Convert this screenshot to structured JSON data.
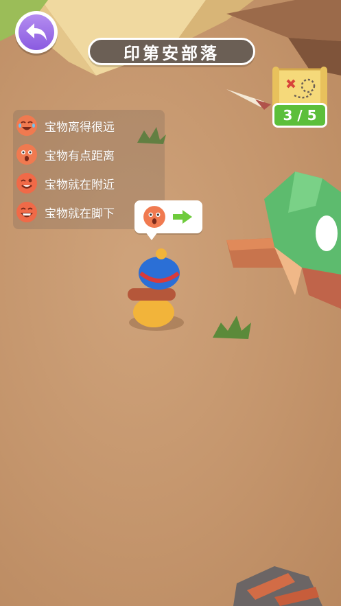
{
  "game": {
    "title": "印第安部落",
    "back_icon": "back-arrow-icon",
    "treasure_progress": {
      "found": 3,
      "total": 5,
      "label": "3 / 5"
    },
    "legend": [
      {
        "label": "宝物离得很远",
        "face": "crying-laugh-face",
        "color": "#f07a50"
      },
      {
        "label": "宝物有点距离",
        "face": "surprised-face",
        "color": "#f07a50"
      },
      {
        "label": "宝物就在附近",
        "face": "wink-face",
        "color": "#f06a48"
      },
      {
        "label": "宝物就在脚下",
        "face": "big-grin-face",
        "color": "#f06a48"
      }
    ],
    "hint_bubble": {
      "face": "surprised-face",
      "arrow": "right-arrow-icon",
      "arrow_color": "#6ecb3c"
    }
  }
}
